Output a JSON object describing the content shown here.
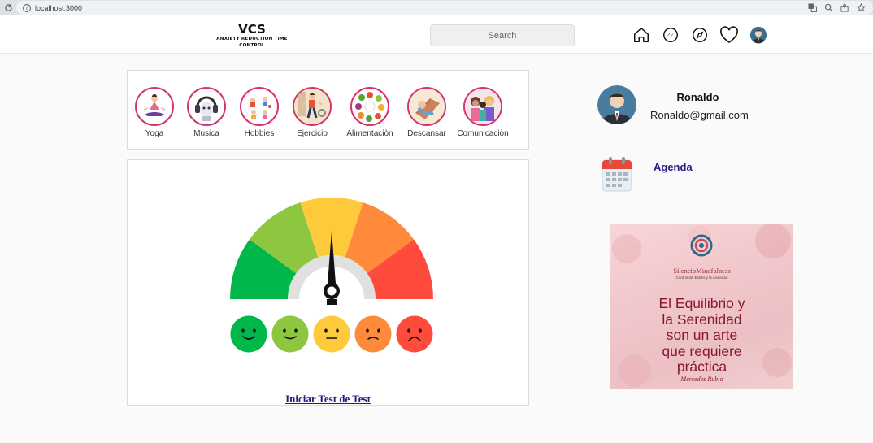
{
  "browser": {
    "url": "localhost:3000"
  },
  "header": {
    "logo_title": "VCS",
    "logo_subtitle_line1": "ANXIETY REDUCTION TIME",
    "logo_subtitle_line2": "CONTROL",
    "search_placeholder": "Search",
    "nav_icons": [
      "home-icon",
      "messenger-icon",
      "explore-compass-icon",
      "heart-icon",
      "profile-avatar"
    ]
  },
  "categories": [
    {
      "label": "Yoga",
      "icon": "yoga-icon"
    },
    {
      "label": "Musica",
      "icon": "music-icon"
    },
    {
      "label": "Hobbies",
      "icon": "hobbies-icon"
    },
    {
      "label": "Ejercicio",
      "icon": "exercise-icon"
    },
    {
      "label": "Alimentaciòn",
      "icon": "food-icon"
    },
    {
      "label": "Descansar",
      "icon": "rest-icon"
    },
    {
      "label": "Comunicaciòn",
      "icon": "communication-icon"
    }
  ],
  "gauge": {
    "colors": [
      "#00b84a",
      "#8dc63f",
      "#ffc93c",
      "#ff8a3c",
      "#ff4b3c"
    ],
    "test_link": "Iniciar Test de Test"
  },
  "profile": {
    "name": "Ronaldo",
    "email": "Ronaldo@gmail.com"
  },
  "agenda": {
    "label": "Agenda"
  },
  "quote": {
    "brand": "SilencioMindfulness",
    "tagline": "Control del Estrés y la Ansiedad",
    "text_lines": [
      "El Equilibrio y",
      "la Serenidad",
      "son un arte",
      "que requiere",
      "práctica"
    ],
    "author": "Mercedes Rubio"
  }
}
